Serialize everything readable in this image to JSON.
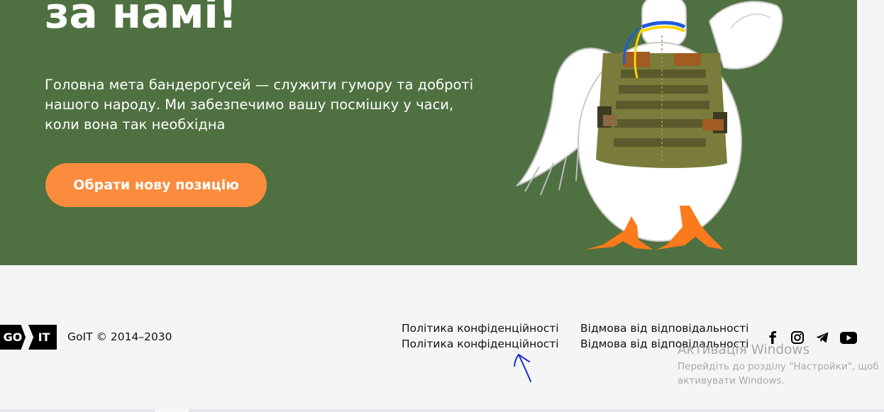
{
  "hero": {
    "title": "за намі!",
    "description": "Головна мета бандерогусей — служити гумору та доброті нашого народу. Ми забезпечимо вашу посмішку у часи, коли вона так необхідна",
    "cta_label": "Обрати нову позицію",
    "background_color": "#4f7040",
    "cta_color": "#fb8c3e"
  },
  "footer": {
    "logo": {
      "left": "GO",
      "right": "IT"
    },
    "copyright": "GoIT © 2014–2030",
    "links": [
      "Політика конфіденційності",
      "Політика конфіденційності",
      "Відмова від відповідальності",
      "Відмова від відповідальності"
    ],
    "social_icons": [
      "facebook-icon",
      "instagram-icon",
      "telegram-icon",
      "youtube-icon"
    ]
  },
  "watermark": {
    "title": "Активація Windows",
    "subtitle": "Перейдіть до розділу \"Настройки\", щоб активувати Windows."
  }
}
